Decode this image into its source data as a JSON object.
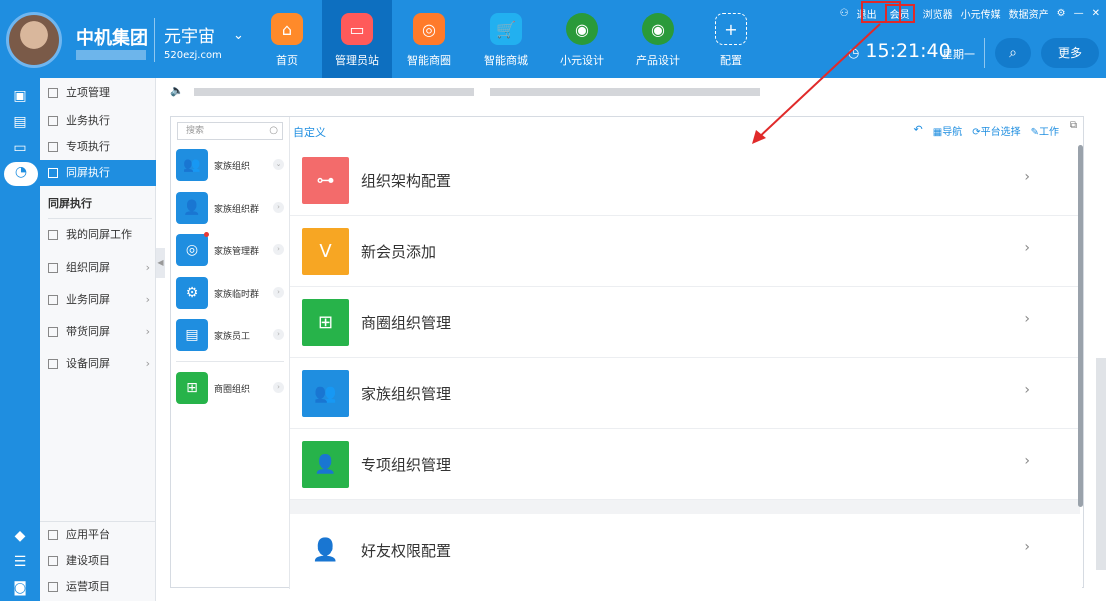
{
  "header": {
    "org_name": "中机集团",
    "world_title": "元宇宙",
    "world_url": "520ezj.com",
    "nav_tabs": [
      {
        "label": "首页",
        "icon": "home-icon",
        "color": "#ff8a2a"
      },
      {
        "label": "管理员站",
        "icon": "monitor-icon",
        "color": "#ff5a5a"
      },
      {
        "label": "智能商圈",
        "icon": "ring-icon",
        "color": "#ff7a2a"
      },
      {
        "label": "智能商城",
        "icon": "cart-icon",
        "color": "#22b0f0"
      },
      {
        "label": "小元设计",
        "icon": "globe-icon",
        "color": "#2a9a3a"
      },
      {
        "label": "产品设计",
        "icon": "globe-people-icon",
        "color": "#2a9a3a"
      },
      {
        "label": "配置",
        "icon": "plus-icon",
        "color": "#1f8ee0"
      }
    ],
    "top_links": [
      "退出",
      "会员",
      "浏览器",
      "小元传媒",
      "数据资产"
    ],
    "time": "15:21:40",
    "weekday": "星期一",
    "more_label": "更多"
  },
  "nav2": {
    "items": [
      "立项管理",
      "业务执行",
      "专项执行",
      "同屏执行"
    ],
    "section_title": "同屏执行",
    "sub_items": [
      "我的同屏工作",
      "组织同屏",
      "业务同屏",
      "带货同屏",
      "设备同屏"
    ],
    "bottom_items": [
      "应用平台",
      "建设项目",
      "运营项目"
    ]
  },
  "groups": {
    "search_placeholder": "搜索",
    "items": [
      {
        "label": "家族组织",
        "color": "#1f8ee0"
      },
      {
        "label": "家族组织群",
        "color": "#1f8ee0"
      },
      {
        "label": "家族管理群",
        "color": "#1f8ee0"
      },
      {
        "label": "家族临时群",
        "color": "#1f8ee0"
      },
      {
        "label": "家族员工",
        "color": "#1f8ee0"
      },
      {
        "label": "商圈组织",
        "color": "#27b34a"
      }
    ]
  },
  "main": {
    "custom_title": "自定义",
    "tools": [
      "导航",
      "平台选择",
      "工作"
    ],
    "rows": [
      {
        "label": "组织架构配置",
        "color": "#f36b6b",
        "icon": "org-chart-icon"
      },
      {
        "label": "新会员添加",
        "color": "#f7a623",
        "icon": "vip-add-icon"
      },
      {
        "label": "商圈组织管理",
        "color": "#27b34a",
        "icon": "hierarchy-icon"
      },
      {
        "label": "家族组织管理",
        "color": "#1f8ee0",
        "icon": "people-icon"
      },
      {
        "label": "专项组织管理",
        "color": "#27b34a",
        "icon": "user-stack-icon"
      },
      {
        "label": "好友权限配置",
        "color": "#e54d5b",
        "icon": "user-settings-icon"
      }
    ]
  }
}
